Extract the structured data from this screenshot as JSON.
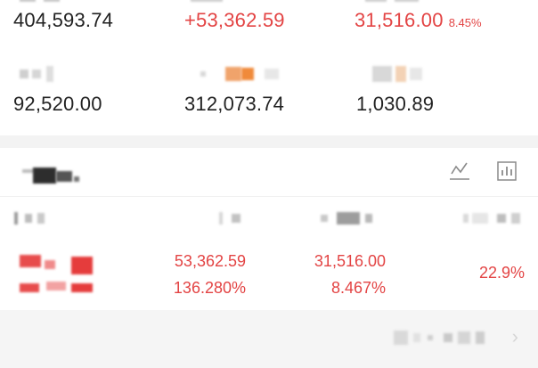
{
  "summary": {
    "row1": {
      "col1_value": "404,593.74",
      "col2_value": "+53,362.59",
      "col3_value": "31,516.00",
      "col3_pct": "8.45%"
    },
    "row2": {
      "col1_value": "92,520.00",
      "col2_value": "312,073.74",
      "col3_value": "1,030.89"
    }
  },
  "holdings": {
    "row": {
      "profit_value": "53,362.59",
      "profit_pct": "136.280%",
      "today_value": "31,516.00",
      "today_pct": "8.467%",
      "ratio": "22.9%"
    }
  },
  "colors": {
    "up_red": "#e34444",
    "text_dark": "#222222",
    "separator": "#f3f3f3"
  },
  "icons": {
    "trend": "line-chart-icon",
    "bars": "bar-chart-icon",
    "more": "chevron-right-icon"
  }
}
